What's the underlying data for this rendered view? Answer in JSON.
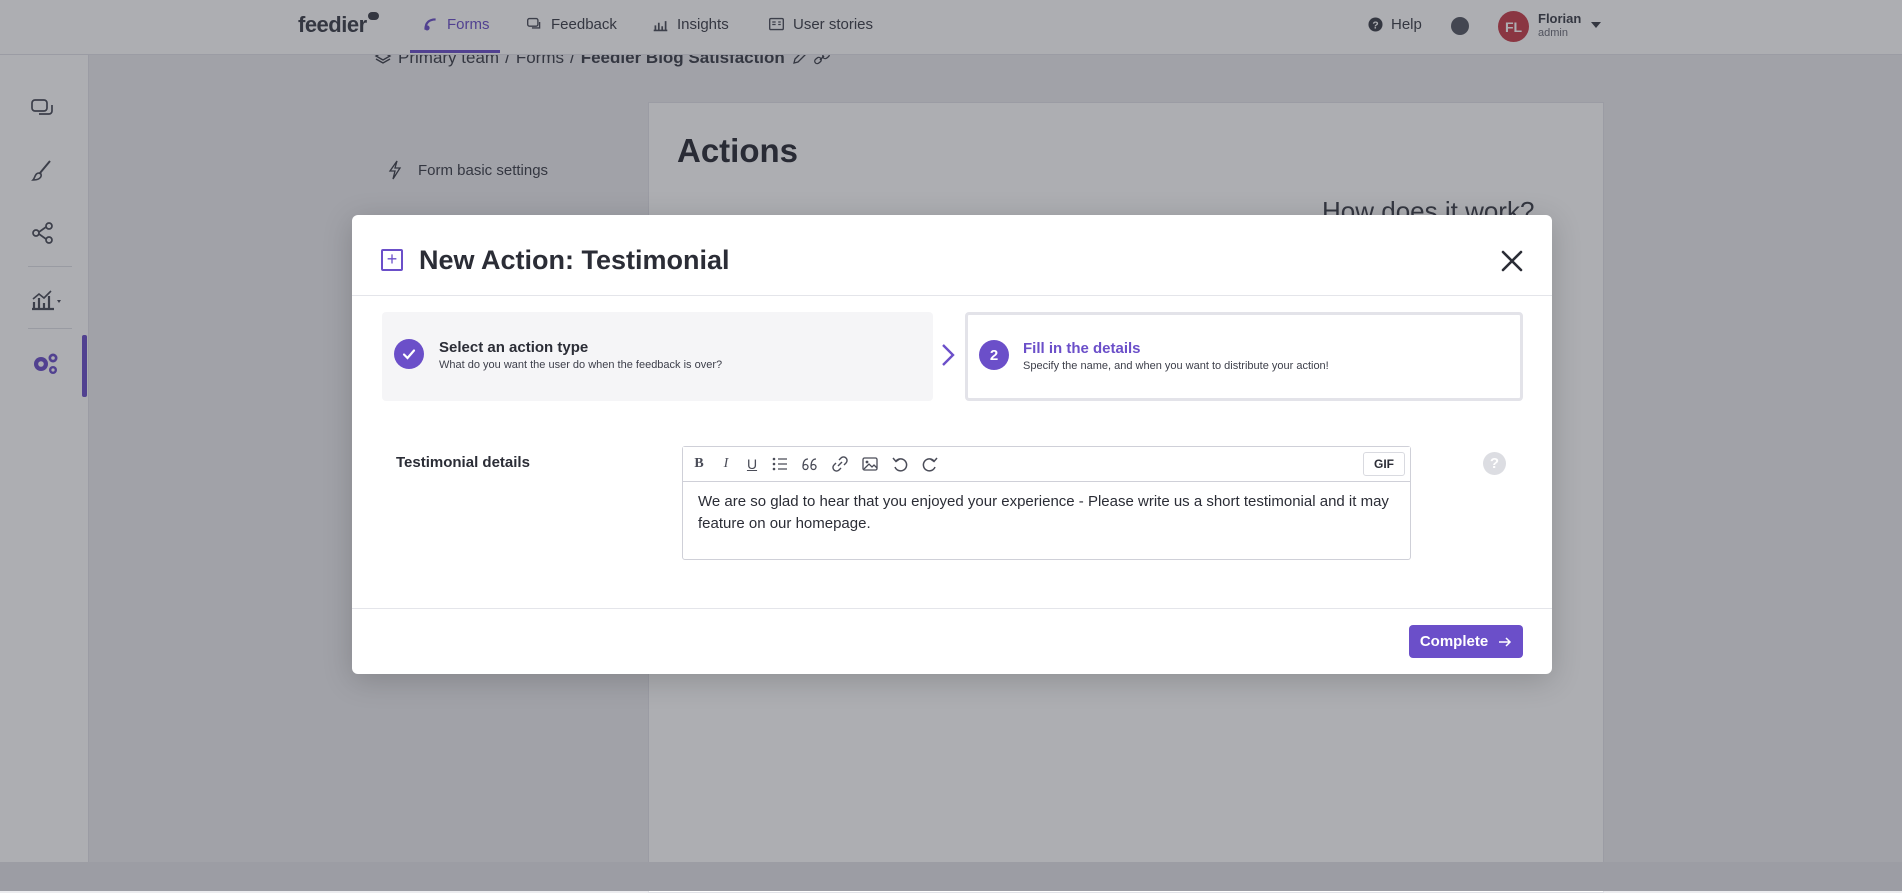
{
  "nav": {
    "logo": "feedier",
    "items": [
      {
        "label": "Forms",
        "icon": "forms-icon"
      },
      {
        "label": "Feedback",
        "icon": "chat-bubble-icon"
      },
      {
        "label": "Insights",
        "icon": "chart-icon"
      },
      {
        "label": "User stories",
        "icon": "stories-icon"
      }
    ],
    "help_label": "Help",
    "user": {
      "initials": "FL",
      "name": "Florian",
      "role": "admin"
    }
  },
  "breadcrumb": {
    "team": "Primary team",
    "sep": "/",
    "section": "Forms",
    "form_name": "Feedier Blog Satisfaction"
  },
  "left_menu": {
    "form_settings": "Form basic settings"
  },
  "page": {
    "title": "Actions",
    "how_title": "How does it work?"
  },
  "modal": {
    "title": "New Action: Testimonial",
    "steps": [
      {
        "number": "",
        "title": "Select an action type",
        "subtitle": "What do you want the user do when the feedback is over?"
      },
      {
        "number": "2",
        "title": "Fill in the details",
        "subtitle": "Specify the name, and when you want to distribute your action!"
      }
    ],
    "field_label": "Testimonial details",
    "toolbar": {
      "gif_label": "GIF"
    },
    "editor_text": "We are so glad to hear that you enjoyed your experience - Please write us a short testimonial and it may feature on our homepage.",
    "complete_label": "Complete"
  },
  "colors": {
    "accent": "#6b4fc9",
    "avatar": "#c73e4b"
  }
}
